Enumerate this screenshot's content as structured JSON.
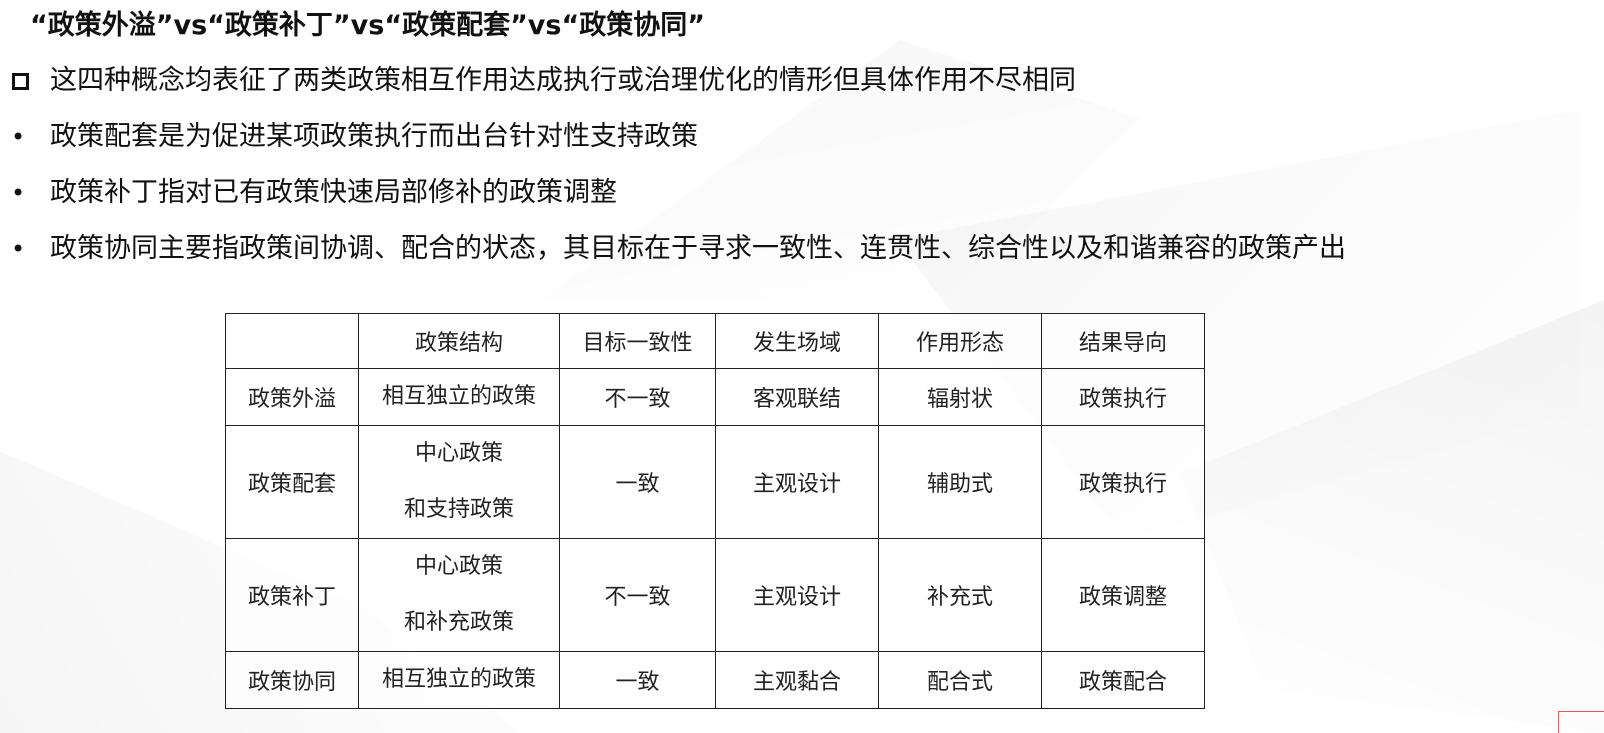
{
  "title": "“政策外溢”vs“政策补丁”vs“政策配套”vs“政策协同”",
  "bullets": [
    {
      "marker": "square",
      "text": "这四种概念均表征了两类政策相互作用达成执行或治理优化的情形但具体作用不尽相同"
    },
    {
      "marker": "•",
      "text": "政策配套是为促进某项政策执行而出台针对性支持政策"
    },
    {
      "marker": "•",
      "text": "政策补丁指对已有政策快速局部修补的政策调整"
    },
    {
      "marker": "•",
      "text": "政策协同主要指政策间协调、配合的状态，其目标在于寻求一致性、连贯性、综合性以及和谐兼容的政策产出"
    }
  ],
  "table": {
    "headers": [
      "",
      "政策结构",
      "目标一致性",
      "发生场域",
      "作用形态",
      "结果导向"
    ],
    "rows": [
      {
        "name": "政策外溢",
        "structure": [
          "相互独立的政策"
        ],
        "consistency": "不一致",
        "field": "客观联结",
        "form": "辐射状",
        "outcome": "政策执行"
      },
      {
        "name": "政策配套",
        "structure": [
          "中心政策",
          "和支持政策"
        ],
        "consistency": "一致",
        "field": "主观设计",
        "form": "辅助式",
        "outcome": "政策执行"
      },
      {
        "name": "政策补丁",
        "structure": [
          "中心政策",
          "和补充政策"
        ],
        "consistency": "不一致",
        "field": "主观设计",
        "form": "补充式",
        "outcome": "政策调整"
      },
      {
        "name": "政策协同",
        "structure": [
          "相互独立的政策"
        ],
        "consistency": "一致",
        "field": "主观黏合",
        "form": "配合式",
        "outcome": "政策配合"
      }
    ]
  }
}
